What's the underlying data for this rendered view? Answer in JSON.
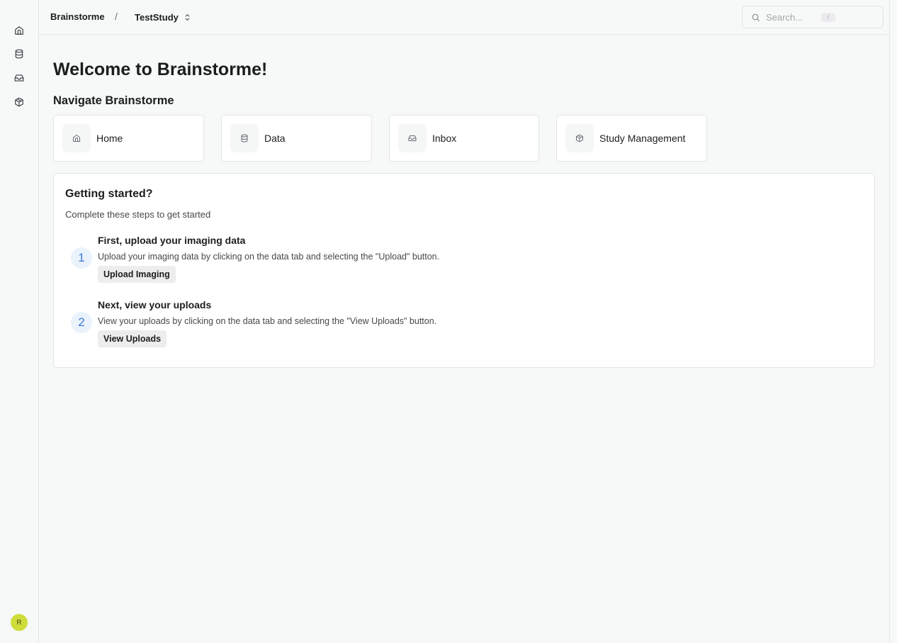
{
  "sidebar": {
    "items": [
      {
        "name": "home",
        "icon": "home-icon"
      },
      {
        "name": "data",
        "icon": "database-icon"
      },
      {
        "name": "inbox",
        "icon": "inbox-icon"
      },
      {
        "name": "study-management",
        "icon": "codesandbox-icon"
      }
    ],
    "avatar_initial": "R",
    "avatar_color": "#cfdd3a"
  },
  "topbar": {
    "breadcrumb_root": "Brainstorme",
    "breadcrumb_separator": "/",
    "study_name": "TestStudy",
    "search_placeholder": "Search...",
    "search_shortcut": "/"
  },
  "main": {
    "title": "Welcome to Brainstorme!",
    "nav_heading": "Navigate Brainstorme",
    "nav_cards": [
      {
        "label": "Home",
        "icon": "home-icon"
      },
      {
        "label": "Data",
        "icon": "database-icon"
      },
      {
        "label": "Inbox",
        "icon": "inbox-icon"
      },
      {
        "label": "Study Management",
        "icon": "codesandbox-icon"
      }
    ],
    "getting_started": {
      "title": "Getting started?",
      "description": "Complete these steps to get started",
      "steps": [
        {
          "number": "1",
          "title": "First, upload your imaging data",
          "description": "Upload your imaging data by clicking on the data tab and selecting the \"Upload\" button.",
          "button_label": "Upload Imaging"
        },
        {
          "number": "2",
          "title": "Next, view your uploads",
          "description": "View your uploads by clicking on the data tab and selecting the \"View Uploads\" button.",
          "button_label": "View Uploads"
        }
      ]
    }
  },
  "colors": {
    "accent": "#3d7bd6",
    "step_badge_bg": "#eaf2fc"
  }
}
